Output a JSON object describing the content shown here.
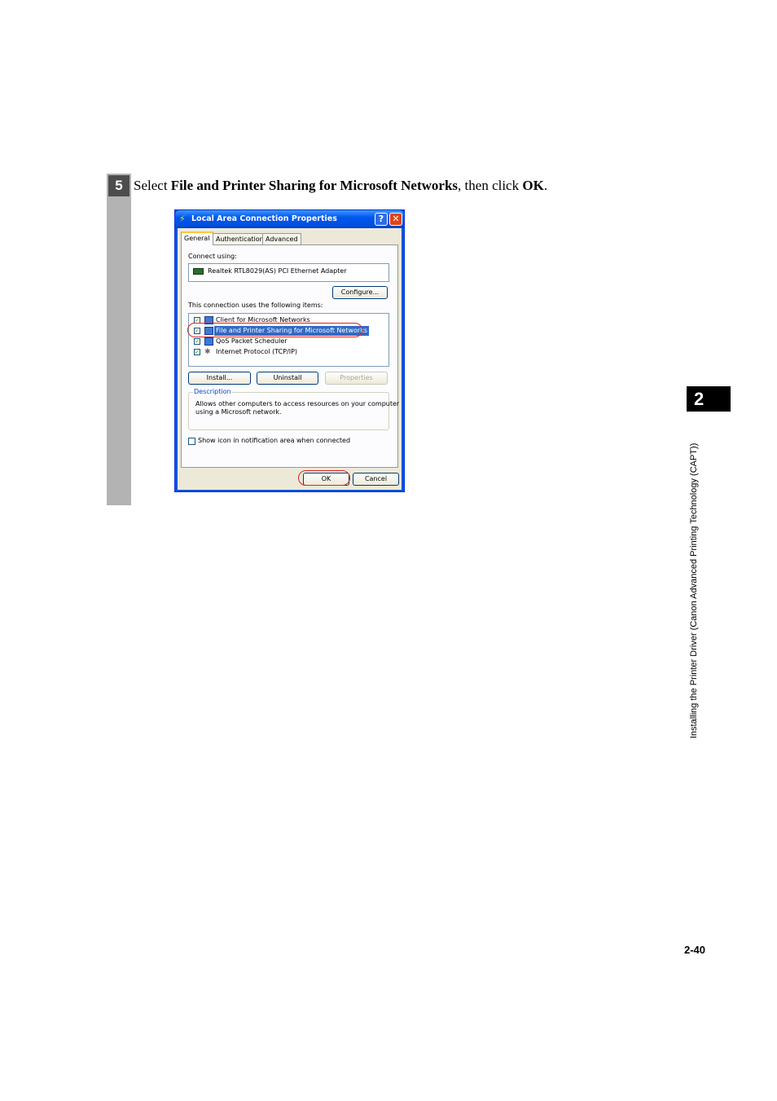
{
  "step": {
    "number": "5",
    "text_pre": "Select ",
    "text_bold1": "File and Printer Sharing for Microsoft Networks",
    "text_mid": ", then click ",
    "text_bold2": "OK",
    "text_post": "."
  },
  "dialog": {
    "title": "Local Area Connection Properties",
    "help_glyph": "?",
    "close_glyph": "✕",
    "tabs": [
      "General",
      "Authentication",
      "Advanced"
    ],
    "connect_using_label": "Connect using:",
    "adapter_name": "Realtek RTL8029(AS) PCI Ethernet Adapter",
    "configure_label": "Configure...",
    "items_label": "This connection uses the following items:",
    "items": [
      {
        "label": "Client for Microsoft Networks",
        "checked": true,
        "icon": "network-client-icon"
      },
      {
        "label": "File and Printer Sharing for Microsoft Networks",
        "checked": true,
        "icon": "file-printer-sharing-icon"
      },
      {
        "label": "QoS Packet Scheduler",
        "checked": true,
        "icon": "qos-icon"
      },
      {
        "label": "Internet Protocol (TCP/IP)",
        "checked": true,
        "icon": "protocol-icon"
      }
    ],
    "check_glyph": "✓",
    "protocol_glyph": "✱",
    "install_label": "Install...",
    "uninstall_label": "Uninstall",
    "properties_label": "Properties",
    "description_title": "Description",
    "description_text_line1": "Allows other computers to access resources on your computer",
    "description_text_line2": "using a Microsoft network.",
    "show_icon_label": "Show icon in notification area when connected",
    "ok_label": "OK",
    "cancel_label": "Cancel"
  },
  "chapter": {
    "number": "2",
    "side_title": "Installing the Printer Driver (Canon Advanced Printing Technology (CAPT))"
  },
  "page_number": "2-40",
  "colors": {
    "highlight": "#e0201c",
    "selection": "#316ac5",
    "titlebar": "#0058ee"
  }
}
